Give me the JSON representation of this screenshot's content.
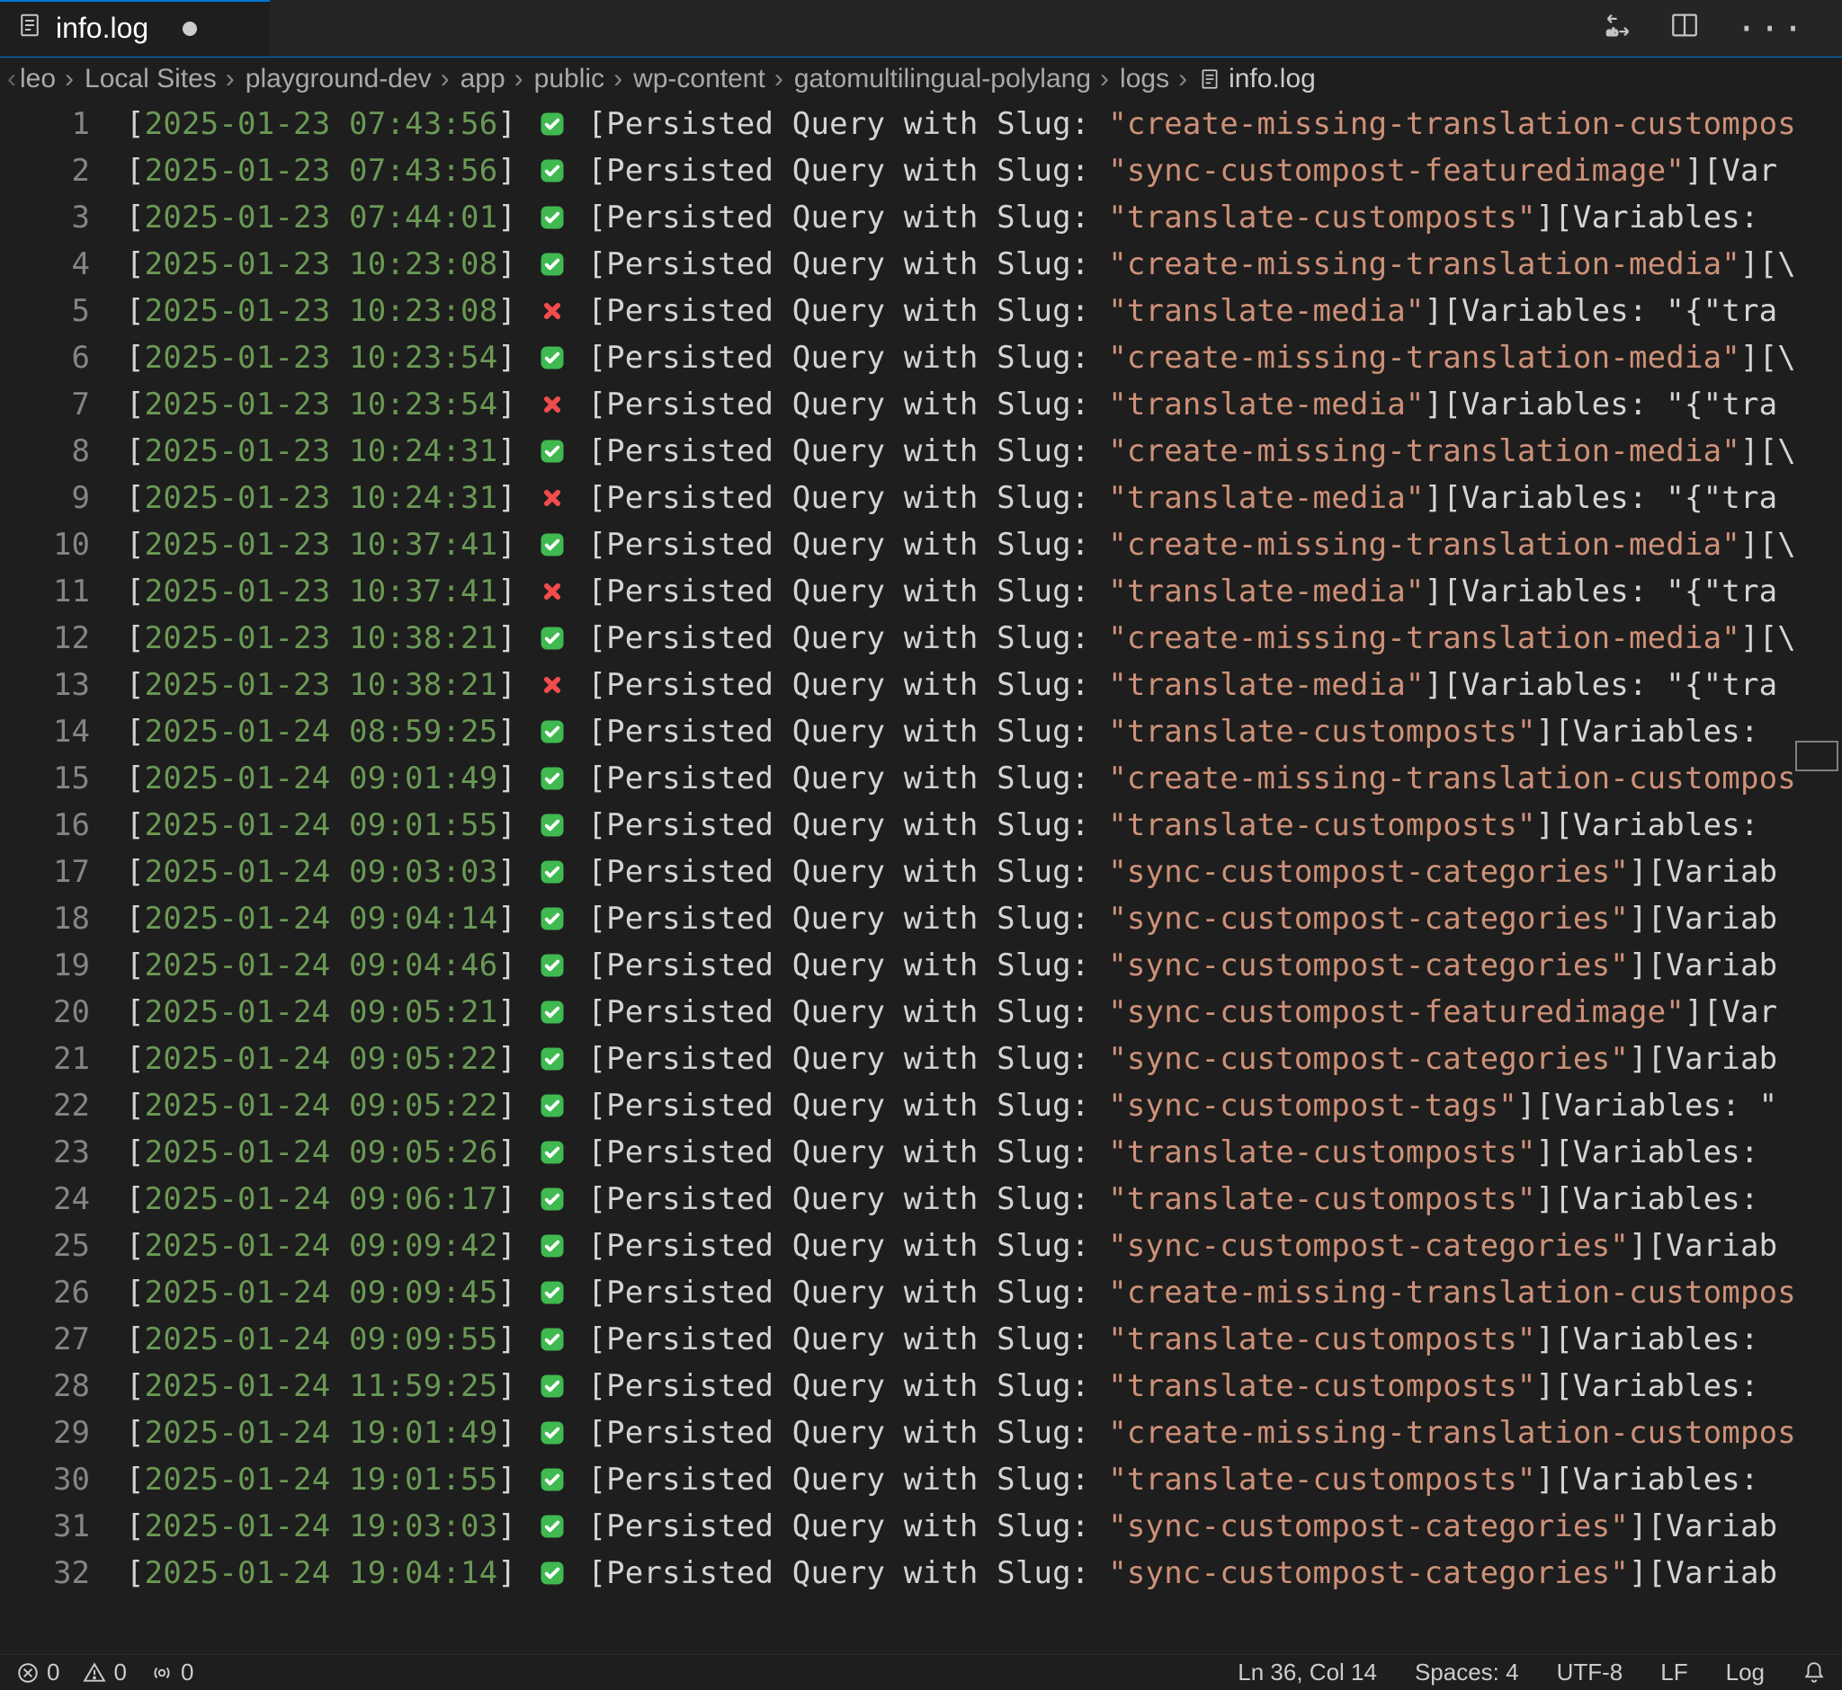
{
  "tab": {
    "filename": "info.log",
    "dirty": true
  },
  "breadcrumbs": [
    "leo",
    "Local Sites",
    "playground-dev",
    "app",
    "public",
    "wp-content",
    "gatomultilingual-polylang",
    "logs",
    "info.log"
  ],
  "statusbar": {
    "errors": "0",
    "warnings": "0",
    "ports": "0",
    "position": "Ln 36, Col 14",
    "indent": "Spaces: 4",
    "encoding": "UTF-8",
    "eol": "LF",
    "language": "Log"
  },
  "log_label": "[Persisted Query with Slug:",
  "lines": [
    {
      "n": 1,
      "ts": "2025-01-23 07:43:56",
      "ok": true,
      "slug": "create-missing-translation-custompos",
      "tail": ""
    },
    {
      "n": 2,
      "ts": "2025-01-23 07:43:56",
      "ok": true,
      "slug": "sync-custompost-featuredimage\"",
      "tail": "][Var"
    },
    {
      "n": 3,
      "ts": "2025-01-23 07:44:01",
      "ok": true,
      "slug": "translate-customposts\"",
      "tail": "][Variables: "
    },
    {
      "n": 4,
      "ts": "2025-01-23 10:23:08",
      "ok": true,
      "slug": "create-missing-translation-media\"",
      "tail": "][\\"
    },
    {
      "n": 5,
      "ts": "2025-01-23 10:23:08",
      "ok": false,
      "slug": "translate-media\"",
      "tail": "][Variables: \"{\"tra"
    },
    {
      "n": 6,
      "ts": "2025-01-23 10:23:54",
      "ok": true,
      "slug": "create-missing-translation-media\"",
      "tail": "][\\"
    },
    {
      "n": 7,
      "ts": "2025-01-23 10:23:54",
      "ok": false,
      "slug": "translate-media\"",
      "tail": "][Variables: \"{\"tra"
    },
    {
      "n": 8,
      "ts": "2025-01-23 10:24:31",
      "ok": true,
      "slug": "create-missing-translation-media\"",
      "tail": "][\\"
    },
    {
      "n": 9,
      "ts": "2025-01-23 10:24:31",
      "ok": false,
      "slug": "translate-media\"",
      "tail": "][Variables: \"{\"tra"
    },
    {
      "n": 10,
      "ts": "2025-01-23 10:37:41",
      "ok": true,
      "slug": "create-missing-translation-media\"",
      "tail": "][\\"
    },
    {
      "n": 11,
      "ts": "2025-01-23 10:37:41",
      "ok": false,
      "slug": "translate-media\"",
      "tail": "][Variables: \"{\"tra"
    },
    {
      "n": 12,
      "ts": "2025-01-23 10:38:21",
      "ok": true,
      "slug": "create-missing-translation-media\"",
      "tail": "][\\"
    },
    {
      "n": 13,
      "ts": "2025-01-23 10:38:21",
      "ok": false,
      "slug": "translate-media\"",
      "tail": "][Variables: \"{\"tra"
    },
    {
      "n": 14,
      "ts": "2025-01-24 08:59:25",
      "ok": true,
      "slug": "translate-customposts\"",
      "tail": "][Variables: "
    },
    {
      "n": 15,
      "ts": "2025-01-24 09:01:49",
      "ok": true,
      "slug": "create-missing-translation-custompos",
      "tail": ""
    },
    {
      "n": 16,
      "ts": "2025-01-24 09:01:55",
      "ok": true,
      "slug": "translate-customposts\"",
      "tail": "][Variables:"
    },
    {
      "n": 17,
      "ts": "2025-01-24 09:03:03",
      "ok": true,
      "slug": "sync-custompost-categories\"",
      "tail": "][Variab"
    },
    {
      "n": 18,
      "ts": "2025-01-24 09:04:14",
      "ok": true,
      "slug": "sync-custompost-categories\"",
      "tail": "][Variab"
    },
    {
      "n": 19,
      "ts": "2025-01-24 09:04:46",
      "ok": true,
      "slug": "sync-custompost-categories\"",
      "tail": "][Variab"
    },
    {
      "n": 20,
      "ts": "2025-01-24 09:05:21",
      "ok": true,
      "slug": "sync-custompost-featuredimage\"",
      "tail": "][Var"
    },
    {
      "n": 21,
      "ts": "2025-01-24 09:05:22",
      "ok": true,
      "slug": "sync-custompost-categories\"",
      "tail": "][Variab"
    },
    {
      "n": 22,
      "ts": "2025-01-24 09:05:22",
      "ok": true,
      "slug": "sync-custompost-tags\"",
      "tail": "][Variables: \""
    },
    {
      "n": 23,
      "ts": "2025-01-24 09:05:26",
      "ok": true,
      "slug": "translate-customposts\"",
      "tail": "][Variables: "
    },
    {
      "n": 24,
      "ts": "2025-01-24 09:06:17",
      "ok": true,
      "slug": "translate-customposts\"",
      "tail": "][Variables: "
    },
    {
      "n": 25,
      "ts": "2025-01-24 09:09:42",
      "ok": true,
      "slug": "sync-custompost-categories\"",
      "tail": "][Variab"
    },
    {
      "n": 26,
      "ts": "2025-01-24 09:09:45",
      "ok": true,
      "slug": "create-missing-translation-custompos",
      "tail": ""
    },
    {
      "n": 27,
      "ts": "2025-01-24 09:09:55",
      "ok": true,
      "slug": "translate-customposts\"",
      "tail": "][Variables: "
    },
    {
      "n": 28,
      "ts": "2025-01-24 11:59:25",
      "ok": true,
      "slug": "translate-customposts\"",
      "tail": "][Variables: "
    },
    {
      "n": 29,
      "ts": "2025-01-24 19:01:49",
      "ok": true,
      "slug": "create-missing-translation-custompos",
      "tail": ""
    },
    {
      "n": 30,
      "ts": "2025-01-24 19:01:55",
      "ok": true,
      "slug": "translate-customposts\"",
      "tail": "][Variables: "
    },
    {
      "n": 31,
      "ts": "2025-01-24 19:03:03",
      "ok": true,
      "slug": "sync-custompost-categories\"",
      "tail": "][Variab"
    },
    {
      "n": 32,
      "ts": "2025-01-24 19:04:14",
      "ok": true,
      "slug": "sync-custompost-categories\"",
      "tail": "][Variab"
    }
  ]
}
